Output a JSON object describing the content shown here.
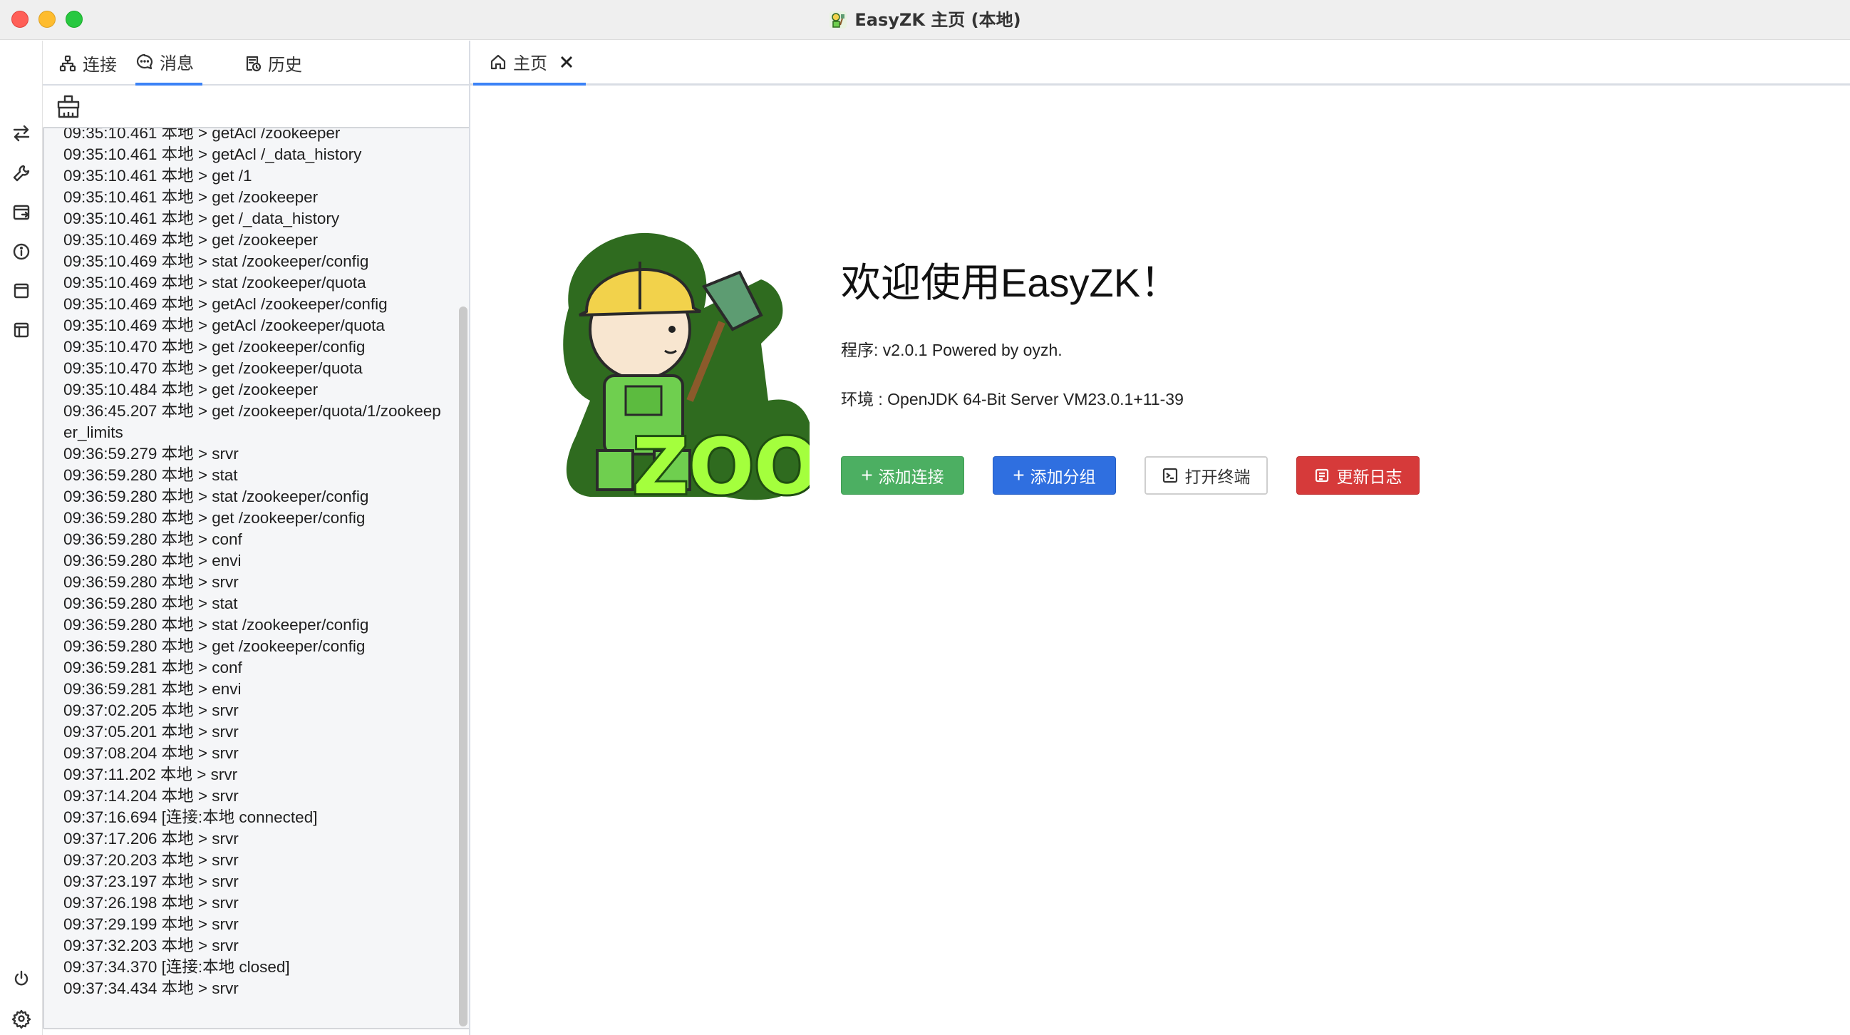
{
  "window": {
    "title": "EasyZK 主页 (本地)"
  },
  "left_tabs": [
    {
      "label": "连接",
      "icon": "connection-icon",
      "active": false
    },
    {
      "label": "消息",
      "icon": "message-icon",
      "active": true
    },
    {
      "label": "历史",
      "icon": "history-icon",
      "active": false
    }
  ],
  "sidebar_icons": [
    "switch-icon",
    "wrench-icon",
    "terminal-window-icon",
    "info-icon",
    "window-icon",
    "layout-icon",
    "power-icon",
    "settings-icon"
  ],
  "log_lines": [
    "09:35:10.461 本地 > getAcl /zookeeper",
    "09:35:10.461 本地 > getAcl /_data_history",
    "09:35:10.461 本地 > get /1",
    "09:35:10.461 本地 > get /zookeeper",
    "09:35:10.461 本地 > get /_data_history",
    "09:35:10.469 本地 > get /zookeeper",
    "09:35:10.469 本地 > stat /zookeeper/config",
    "09:35:10.469 本地 > stat /zookeeper/quota",
    "09:35:10.469 本地 > getAcl /zookeeper/config",
    "09:35:10.469 本地 > getAcl /zookeeper/quota",
    "09:35:10.470 本地 > get /zookeeper/config",
    "09:35:10.470 本地 > get /zookeeper/quota",
    "09:35:10.484 本地 > get /zookeeper",
    "09:36:45.207 本地 > get /zookeeper/quota/1/zookeeper_limits",
    "09:36:59.279 本地 > srvr",
    "09:36:59.280 本地 > stat",
    "09:36:59.280 本地 > stat /zookeeper/config",
    "09:36:59.280 本地 > get /zookeeper/config",
    "09:36:59.280 本地 > conf",
    "09:36:59.280 本地 > envi",
    "09:36:59.280 本地 > srvr",
    "09:36:59.280 本地 > stat",
    "09:36:59.280 本地 > stat /zookeeper/config",
    "09:36:59.280 本地 > get /zookeeper/config",
    "09:36:59.281 本地 > conf",
    "09:36:59.281 本地 > envi",
    "09:37:02.205 本地 > srvr",
    "09:37:05.201 本地 > srvr",
    "09:37:08.204 本地 > srvr",
    "09:37:11.202 本地 > srvr",
    "09:37:14.204 本地 > srvr",
    "09:37:16.694 [连接:本地 connected]",
    "09:37:17.206 本地 > srvr",
    "09:37:20.203 本地 > srvr",
    "09:37:23.197 本地 > srvr",
    "09:37:26.198 本地 > srvr",
    "09:37:29.199 本地 > srvr",
    "09:37:32.203 本地 > srvr",
    "09:37:34.370 [连接:本地 closed]",
    "09:37:34.434 本地 > srvr"
  ],
  "main_tab": {
    "label": "主页"
  },
  "welcome": {
    "title": "欢迎使用EasyZK！",
    "program": "程序: v2.0.1 Powered by oyzh.",
    "env": "环境 : OpenJDK 64-Bit Server VM23.0.1+11-39",
    "logo_text": "ZOO"
  },
  "buttons": {
    "add_connection": "添加连接",
    "add_group": "添加分组",
    "open_terminal": "打开终端",
    "changelog": "更新日志"
  },
  "colors": {
    "accent": "#3b82f6",
    "green": "#4caf62",
    "blue": "#2f6fe0",
    "red": "#d63a3a"
  }
}
